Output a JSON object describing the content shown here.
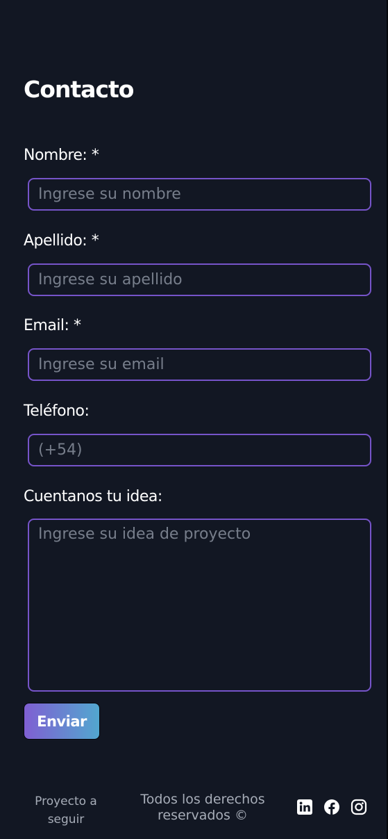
{
  "page": {
    "title": "Contacto"
  },
  "form": {
    "nombre": {
      "label": "Nombre: *",
      "placeholder": "Ingrese su nombre",
      "value": ""
    },
    "apellido": {
      "label": "Apellido: *",
      "placeholder": "Ingrese su apellido",
      "value": ""
    },
    "email": {
      "label": "Email: *",
      "placeholder": "Ingrese su email",
      "value": ""
    },
    "telefono": {
      "label": "Teléfono:",
      "placeholder": "(+54)",
      "value": ""
    },
    "idea": {
      "label": "Cuentanos tu idea:",
      "placeholder": "Ingrese su idea de proyecto",
      "value": ""
    },
    "submit_label": "Enviar"
  },
  "footer": {
    "project_line1": "Proyecto a",
    "project_line2": "seguir",
    "rights_line1": "Todos los derechos",
    "rights_line2": "reservados ©",
    "social_icons": [
      "linkedin-icon",
      "facebook-icon",
      "instagram-icon"
    ]
  },
  "colors": {
    "background": "#121723",
    "input_border": "#7654c9",
    "placeholder": "#777e8b",
    "button_gradient_start": "#7f5fd2",
    "button_gradient_end": "#52a7cf",
    "footer_text": "#a7adb8"
  }
}
